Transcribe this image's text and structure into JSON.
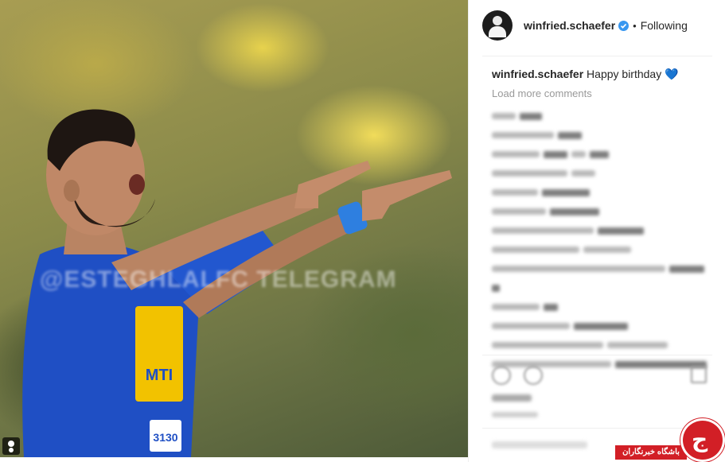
{
  "post": {
    "username": "winfried.schaefer",
    "follow_status": "Following",
    "separator": "•",
    "caption_username": "winfried.schaefer",
    "caption_text": "Happy birthday 💙",
    "load_more": "Load more comments",
    "watermark": "@ESTEGHLALFC TELEGRAM"
  },
  "jersey": {
    "sponsor": "MTI",
    "number": "3130"
  },
  "site_logo": {
    "text": "باشگاه خبرنگاران",
    "glyph": "ج"
  },
  "colors": {
    "verified_blue": "#3897f0",
    "jersey_blue": "#1f4fc4",
    "logo_red": "#d21f26"
  },
  "icons": {
    "verified": "verified-badge-icon",
    "like": "heart-icon",
    "comment": "comment-icon",
    "save": "bookmark-icon",
    "user_tag": "user-tag-icon"
  }
}
